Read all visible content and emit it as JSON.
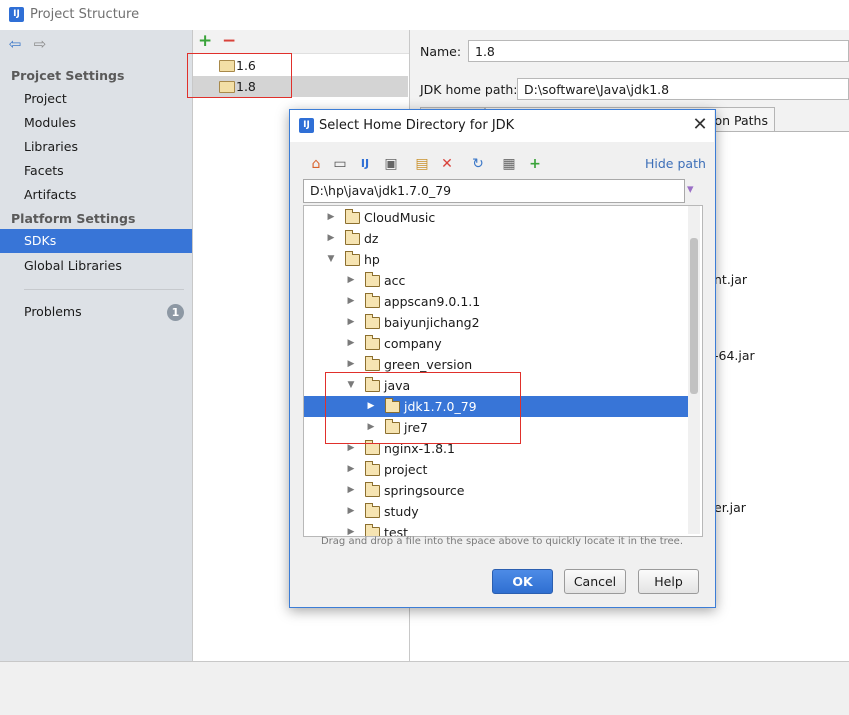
{
  "window": {
    "title": "Project Structure",
    "logo_text": "IJ"
  },
  "sidebar": {
    "nav_back": "⇦",
    "nav_forward": "⇨",
    "project_settings_title": "Projcet Settings",
    "project_settings_items": [
      "Project",
      "Modules",
      "Libraries",
      "Facets",
      "Artifacts"
    ],
    "platform_settings_title": "Platform Settings",
    "platform_settings_items": [
      "SDKs",
      "Global Libraries"
    ],
    "selected_item": "SDKs",
    "problems_label": "Problems",
    "problems_count": "1"
  },
  "sdk_list": {
    "add_icon": "+",
    "remove_icon": "−",
    "items": [
      "1.6",
      "1.8"
    ],
    "selected": "1.8"
  },
  "details": {
    "name_label": "Name:",
    "name_value": "1.8",
    "jdk_home_label": "JDK home path:",
    "jdk_home_value": "D:\\software\\Java\\jdk1.8",
    "visible_tab_fragment": "ion Paths",
    "background_fragments": [
      "nt.jar",
      "-64.jar",
      "er.jar"
    ]
  },
  "dialog": {
    "title": "Select Home Directory for JDK",
    "close_icon": "✕",
    "hide_path_label": "Hide path",
    "path_value": "D:\\hp\\java\\jdk1.7.0_79",
    "toolbar_icons": [
      "home-icon",
      "desktop-icon",
      "project-icon",
      "module-icon",
      "new-folder-icon",
      "delete-icon",
      "refresh-icon",
      "show-hidden-icon",
      "expand-icon"
    ],
    "tree": [
      {
        "label": "CloudMusic",
        "depth": 1,
        "expanded": false
      },
      {
        "label": "dz",
        "depth": 1,
        "expanded": false
      },
      {
        "label": "hp",
        "depth": 1,
        "expanded": true
      },
      {
        "label": "acc",
        "depth": 2,
        "expanded": false
      },
      {
        "label": "appscan9.0.1.1",
        "depth": 2,
        "expanded": false
      },
      {
        "label": "baiyunjichang2",
        "depth": 2,
        "expanded": false
      },
      {
        "label": "company",
        "depth": 2,
        "expanded": false
      },
      {
        "label": "green_version",
        "depth": 2,
        "expanded": false
      },
      {
        "label": "java",
        "depth": 2,
        "expanded": true
      },
      {
        "label": "jdk1.7.0_79",
        "depth": 3,
        "expanded": false,
        "selected": true
      },
      {
        "label": "jre7",
        "depth": 3,
        "expanded": false
      },
      {
        "label": "nginx-1.8.1",
        "depth": 2,
        "expanded": false
      },
      {
        "label": "project",
        "depth": 2,
        "expanded": false
      },
      {
        "label": "springsource",
        "depth": 2,
        "expanded": false
      },
      {
        "label": "study",
        "depth": 2,
        "expanded": false
      },
      {
        "label": "test",
        "depth": 2,
        "expanded": false
      }
    ],
    "hint": "Drag and drop a file into the space above to quickly locate it in the tree.",
    "ok_label": "OK",
    "cancel_label": "Cancel",
    "help_label": "Help"
  },
  "colors": {
    "selection": "#3875d7",
    "annotation_red": "#e0302b"
  }
}
